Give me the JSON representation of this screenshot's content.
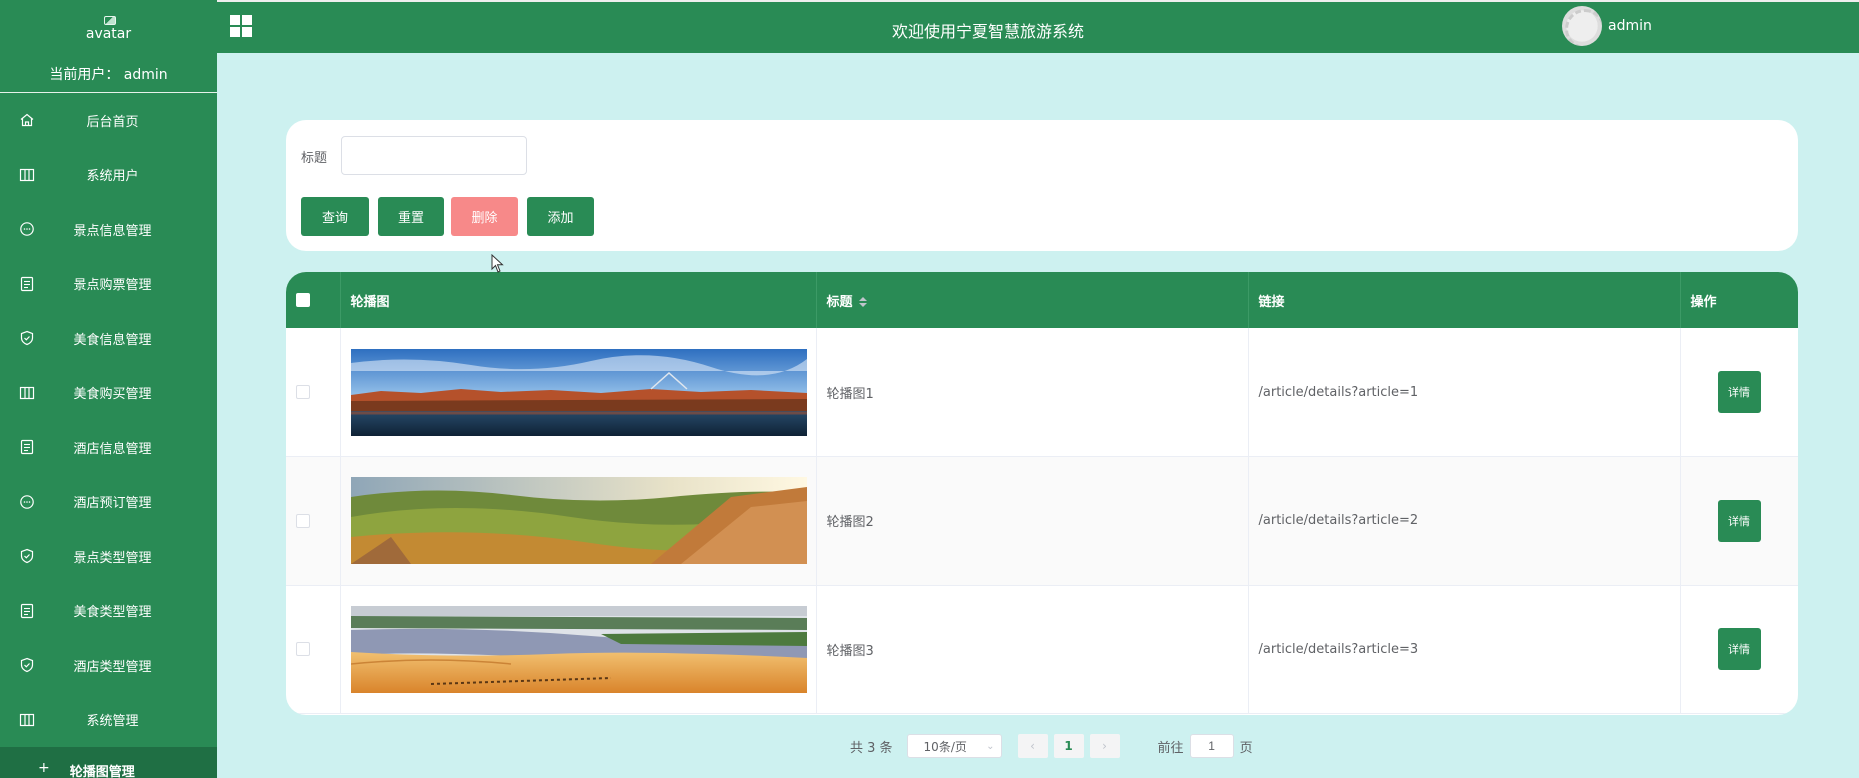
{
  "sidebar": {
    "avatar_alt": "avatar",
    "current_user": "当前用户： admin",
    "items": [
      {
        "label": "后台首页",
        "icon": "home-icon"
      },
      {
        "label": "系统用户",
        "icon": "columns-icon"
      },
      {
        "label": "景点信息管理",
        "icon": "chat-icon"
      },
      {
        "label": "景点购票管理",
        "icon": "document-icon"
      },
      {
        "label": "美食信息管理",
        "icon": "shield-check-icon"
      },
      {
        "label": "美食购买管理",
        "icon": "columns-icon"
      },
      {
        "label": "酒店信息管理",
        "icon": "document-icon"
      },
      {
        "label": "酒店预订管理",
        "icon": "chat-icon"
      },
      {
        "label": "景点类型管理",
        "icon": "shield-check-icon"
      },
      {
        "label": "美食类型管理",
        "icon": "document-icon"
      },
      {
        "label": "酒店类型管理",
        "icon": "shield-check-icon"
      },
      {
        "label": "系统管理",
        "icon": "columns-icon"
      }
    ],
    "sub_item": {
      "label": "轮播图管理",
      "icon": "plus-icon"
    }
  },
  "header": {
    "title": "欢迎使用宁夏智慧旅游系统",
    "username": "admin"
  },
  "search": {
    "label": "标题",
    "value": "",
    "placeholder": "",
    "buttons": {
      "query": "查询",
      "reset": "重置",
      "delete": "删除",
      "add": "添加"
    }
  },
  "table": {
    "columns": [
      "轮播图",
      "标题",
      "链接",
      "操作"
    ],
    "rows": [
      {
        "title": "轮播图1",
        "link": "/article/details?article=1",
        "action": "详情",
        "image": "lake-cliffs-image"
      },
      {
        "title": "轮播图2",
        "link": "/article/details?article=2",
        "action": "详情",
        "image": "green-valley-image"
      },
      {
        "title": "轮播图3",
        "link": "/article/details?article=3",
        "action": "详情",
        "image": "desert-river-image"
      }
    ]
  },
  "pagination": {
    "total": "共 3 条",
    "page_size": "10条/页",
    "current_page": "1",
    "goto_label": "前往",
    "goto_value": "1",
    "page_suffix": "页"
  },
  "colors": {
    "primary": "#298b55",
    "background": "#cdf1f0",
    "danger": "#f78989"
  }
}
